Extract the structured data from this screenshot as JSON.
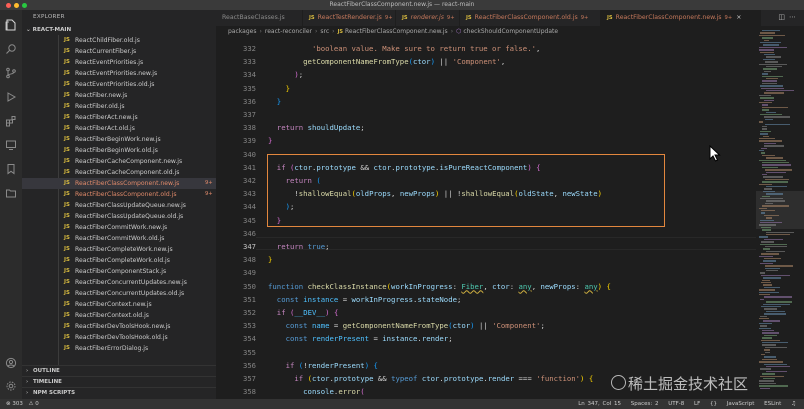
{
  "window": {
    "title": "ReactFiberClassComponent.new.js — react-main"
  },
  "colors": {
    "accent_box": "#e2873e",
    "modified": "#e08a6a",
    "js_badge": "#d7ba3f"
  },
  "sidebar": {
    "header": "EXPLORER",
    "section": "REACT-MAIN",
    "files": [
      {
        "name": "ReactChildFiber.old.js",
        "modified": false,
        "badge": ""
      },
      {
        "name": "ReactCurrentFiber.js",
        "modified": false,
        "badge": ""
      },
      {
        "name": "ReactEventPriorities.js",
        "modified": false,
        "badge": ""
      },
      {
        "name": "ReactEventPriorities.new.js",
        "modified": false,
        "badge": ""
      },
      {
        "name": "ReactEventPriorities.old.js",
        "modified": false,
        "badge": ""
      },
      {
        "name": "ReactFiber.new.js",
        "modified": false,
        "badge": ""
      },
      {
        "name": "ReactFiber.old.js",
        "modified": false,
        "badge": ""
      },
      {
        "name": "ReactFiberAct.new.js",
        "modified": false,
        "badge": ""
      },
      {
        "name": "ReactFiberAct.old.js",
        "modified": false,
        "badge": ""
      },
      {
        "name": "ReactFiberBeginWork.new.js",
        "modified": false,
        "badge": ""
      },
      {
        "name": "ReactFiberBeginWork.old.js",
        "modified": false,
        "badge": ""
      },
      {
        "name": "ReactFiberCacheComponent.new.js",
        "modified": false,
        "badge": ""
      },
      {
        "name": "ReactFiberCacheComponent.old.js",
        "modified": false,
        "badge": ""
      },
      {
        "name": "ReactFiberClassComponent.new.js",
        "modified": true,
        "badge": "9+"
      },
      {
        "name": "ReactFiberClassComponent.old.js",
        "modified": true,
        "badge": "9+"
      },
      {
        "name": "ReactFiberClassUpdateQueue.new.js",
        "modified": false,
        "badge": ""
      },
      {
        "name": "ReactFiberClassUpdateQueue.old.js",
        "modified": false,
        "badge": ""
      },
      {
        "name": "ReactFiberCommitWork.new.js",
        "modified": false,
        "badge": ""
      },
      {
        "name": "ReactFiberCommitWork.old.js",
        "modified": false,
        "badge": ""
      },
      {
        "name": "ReactFiberCompleteWork.new.js",
        "modified": false,
        "badge": ""
      },
      {
        "name": "ReactFiberCompleteWork.old.js",
        "modified": false,
        "badge": ""
      },
      {
        "name": "ReactFiberComponentStack.js",
        "modified": false,
        "badge": ""
      },
      {
        "name": "ReactFiberConcurrentUpdates.new.js",
        "modified": false,
        "badge": ""
      },
      {
        "name": "ReactFiberConcurrentUpdates.old.js",
        "modified": false,
        "badge": ""
      },
      {
        "name": "ReactFiberContext.new.js",
        "modified": false,
        "badge": ""
      },
      {
        "name": "ReactFiberContext.old.js",
        "modified": false,
        "badge": ""
      },
      {
        "name": "ReactFiberDevToolsHook.new.js",
        "modified": false,
        "badge": ""
      },
      {
        "name": "ReactFiberDevToolsHook.old.js",
        "modified": false,
        "badge": ""
      },
      {
        "name": "ReactFiberErrorDialog.js",
        "modified": false,
        "badge": ""
      }
    ],
    "bottom_sections": [
      "OUTLINE",
      "TIMELINE",
      "NPM SCRIPTS"
    ]
  },
  "tabs": [
    {
      "label": "ReactBaseClasses.js",
      "badge": "",
      "modified": false,
      "italic": false,
      "active": false
    },
    {
      "label": "ReactTestRenderer.js",
      "badge": "9+",
      "modified": true,
      "italic": false,
      "active": false
    },
    {
      "label": "renderer.js",
      "badge": "9+",
      "modified": true,
      "italic": true,
      "active": false
    },
    {
      "label": "ReactFiberClassComponent.old.js",
      "badge": "9+",
      "modified": true,
      "italic": false,
      "active": false
    },
    {
      "label": "ReactFiberClassComponent.new.js",
      "badge": "9+",
      "modified": true,
      "italic": false,
      "active": true
    }
  ],
  "tab_badge_js": "JS",
  "breadcrumb": {
    "items": [
      "packages",
      "react-reconciler",
      "src",
      "ReactFiberClassComponent.new.js",
      "checkShouldComponentUpdate"
    ]
  },
  "editor": {
    "line_numbers": [
      "332",
      "333",
      "334",
      "335",
      "336",
      "337",
      "338",
      "339",
      "340",
      "341",
      "342",
      "343",
      "344",
      "345",
      "346",
      "347",
      "348",
      "349",
      "350",
      "351",
      "352",
      "353",
      "354",
      "355",
      "356",
      "357",
      "358"
    ],
    "current_line": "347"
  },
  "statusbar": {
    "errors": "303",
    "warnings": "0",
    "position": "Ln 347, Col 15",
    "spaces": "Spaces: 2",
    "encoding": "UTF-8",
    "eol": "LF",
    "language": "JavaScript",
    "linter": "ESLint"
  },
  "watermark": "稀土掘金技术社区"
}
